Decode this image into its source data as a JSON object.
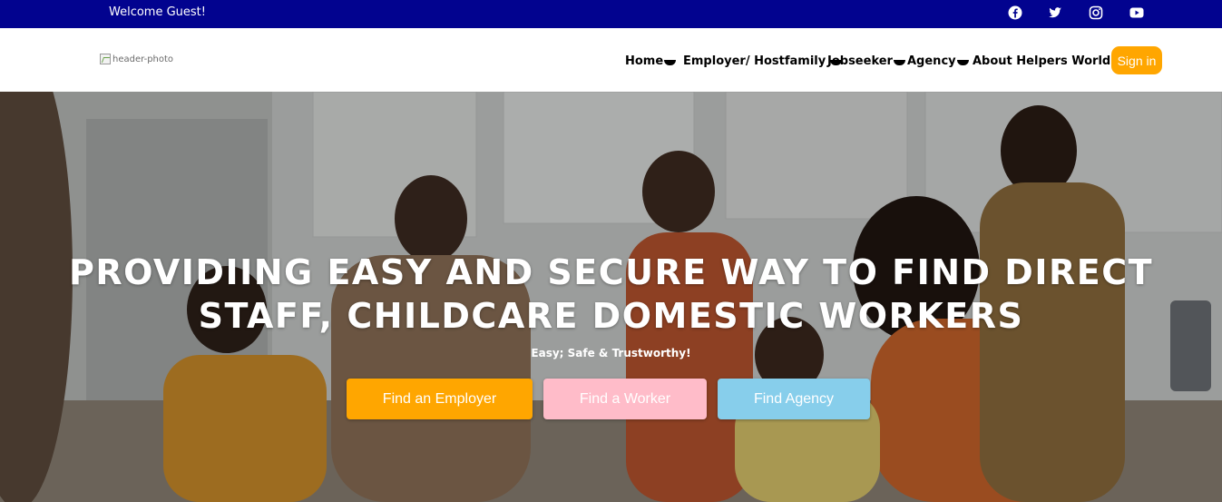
{
  "topbar": {
    "welcome": "Welcome Guest!",
    "background": "#02038f",
    "social": [
      {
        "name": "facebook-icon"
      },
      {
        "name": "twitter-icon"
      },
      {
        "name": "instagram-icon"
      },
      {
        "name": "youtube-icon"
      }
    ]
  },
  "header": {
    "logo_alt": "header-photo",
    "nav": [
      {
        "label": "Home"
      },
      {
        "label": "Employer/ Hostfamily"
      },
      {
        "label": "Jobseeker"
      },
      {
        "label": "Agency"
      },
      {
        "label": "About Helpers World"
      }
    ],
    "signin": "Sign in",
    "signin_color": "#ffa600"
  },
  "hero": {
    "title": "PROVIDIING EASY AND SECURE WAY TO FIND DIRECT STAFF, CHILDCARE DOMESTIC WORKERS",
    "subtitle": "Easy; Safe & Trustworthy!",
    "buttons": [
      {
        "label": "Find an Employer",
        "color": "#ffa600"
      },
      {
        "label": "Find a Worker",
        "color": "#ffbcc9"
      },
      {
        "label": "Find Agency",
        "color": "#87ceeb"
      }
    ]
  }
}
